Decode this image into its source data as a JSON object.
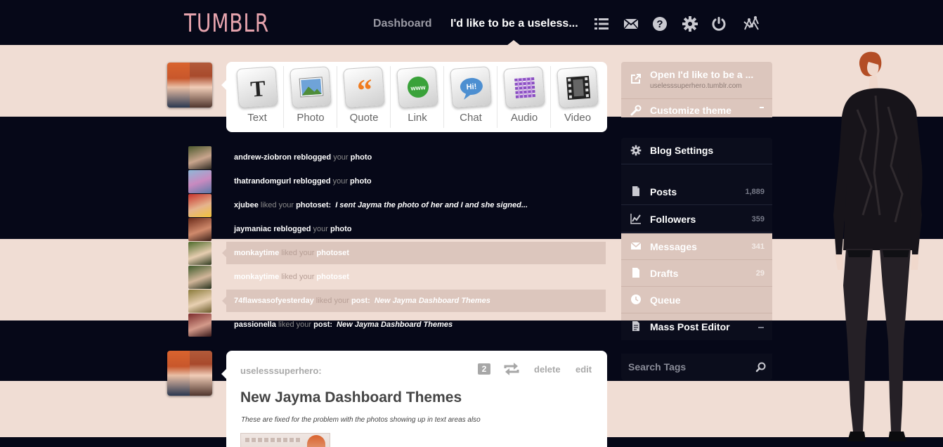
{
  "header": {
    "logo": "TUMBLR",
    "nav_dashboard": "Dashboard",
    "nav_blog": "I'd like to be a useless...",
    "icons": [
      "list-icon",
      "mail-icon",
      "help-icon",
      "gear-icon",
      "power-icon",
      "radar-icon"
    ]
  },
  "composer": {
    "types": [
      {
        "label": "Text",
        "icon": "text-post-icon"
      },
      {
        "label": "Photo",
        "icon": "photo-post-icon"
      },
      {
        "label": "Quote",
        "icon": "quote-post-icon"
      },
      {
        "label": "Link",
        "icon": "link-post-icon"
      },
      {
        "label": "Chat",
        "icon": "chat-post-icon"
      },
      {
        "label": "Audio",
        "icon": "audio-post-icon"
      },
      {
        "label": "Video",
        "icon": "video-post-icon"
      }
    ]
  },
  "activity": [
    {
      "user": "andrew-ziobron",
      "verb": "reblogged",
      "your": "your",
      "object": "photo",
      "quote": ""
    },
    {
      "user": "thatrandomgurl",
      "verb": "reblogged",
      "your": "your",
      "object": "photo",
      "quote": ""
    },
    {
      "user": "xjubee",
      "verb": "liked",
      "your": "your",
      "object": "photoset:",
      "quote": "I sent Jayma the photo of her and I and she signed..."
    },
    {
      "user": "jaymaniac",
      "verb": "reblogged",
      "your": "your",
      "object": "photo",
      "quote": ""
    },
    {
      "user": "monkaytime",
      "verb": "liked",
      "your": "your",
      "object": "photoset",
      "quote": ""
    },
    {
      "user": "monkaytime",
      "verb": "liked",
      "your": "your",
      "object": "photoset",
      "quote": ""
    },
    {
      "user": "74flawsasofyesterday",
      "verb": "liked",
      "your": "your",
      "object": "post:",
      "quote": "New Jayma Dashboard Themes"
    },
    {
      "user": "passionella",
      "verb": "liked",
      "your": "your",
      "object": "post:",
      "quote": "New Jayma Dashboard Themes"
    }
  ],
  "sidebar": {
    "open_blog": "Open I'd like to be a ...",
    "blog_url": "uselesssuperhero.tumblr.com",
    "customize": "Customize theme",
    "blog_settings": "Blog Settings",
    "items": [
      {
        "label": "Posts",
        "count": "1,889",
        "icon": "posts-icon"
      },
      {
        "label": "Followers",
        "count": "359",
        "icon": "followers-icon"
      },
      {
        "label": "Messages",
        "count": "341",
        "icon": "messages-icon"
      },
      {
        "label": "Drafts",
        "count": "29",
        "icon": "drafts-icon"
      },
      {
        "label": "Queue",
        "count": "",
        "icon": "queue-icon"
      },
      {
        "label": "Mass Post Editor",
        "count": "",
        "icon": "mass-editor-icon"
      }
    ],
    "search_placeholder": "Search Tags"
  },
  "post": {
    "author": "uselesssuperhero:",
    "notes": "2",
    "delete": "delete",
    "edit": "edit",
    "title": "New Jayma Dashboard Themes",
    "body": "These are fixed for the problem with the photos showing up in text areas also"
  },
  "colors": {
    "dark": "#060818",
    "pink": "#f0ddd4",
    "logo": "#e6a3ad",
    "highlight": "#dcc6bd"
  }
}
